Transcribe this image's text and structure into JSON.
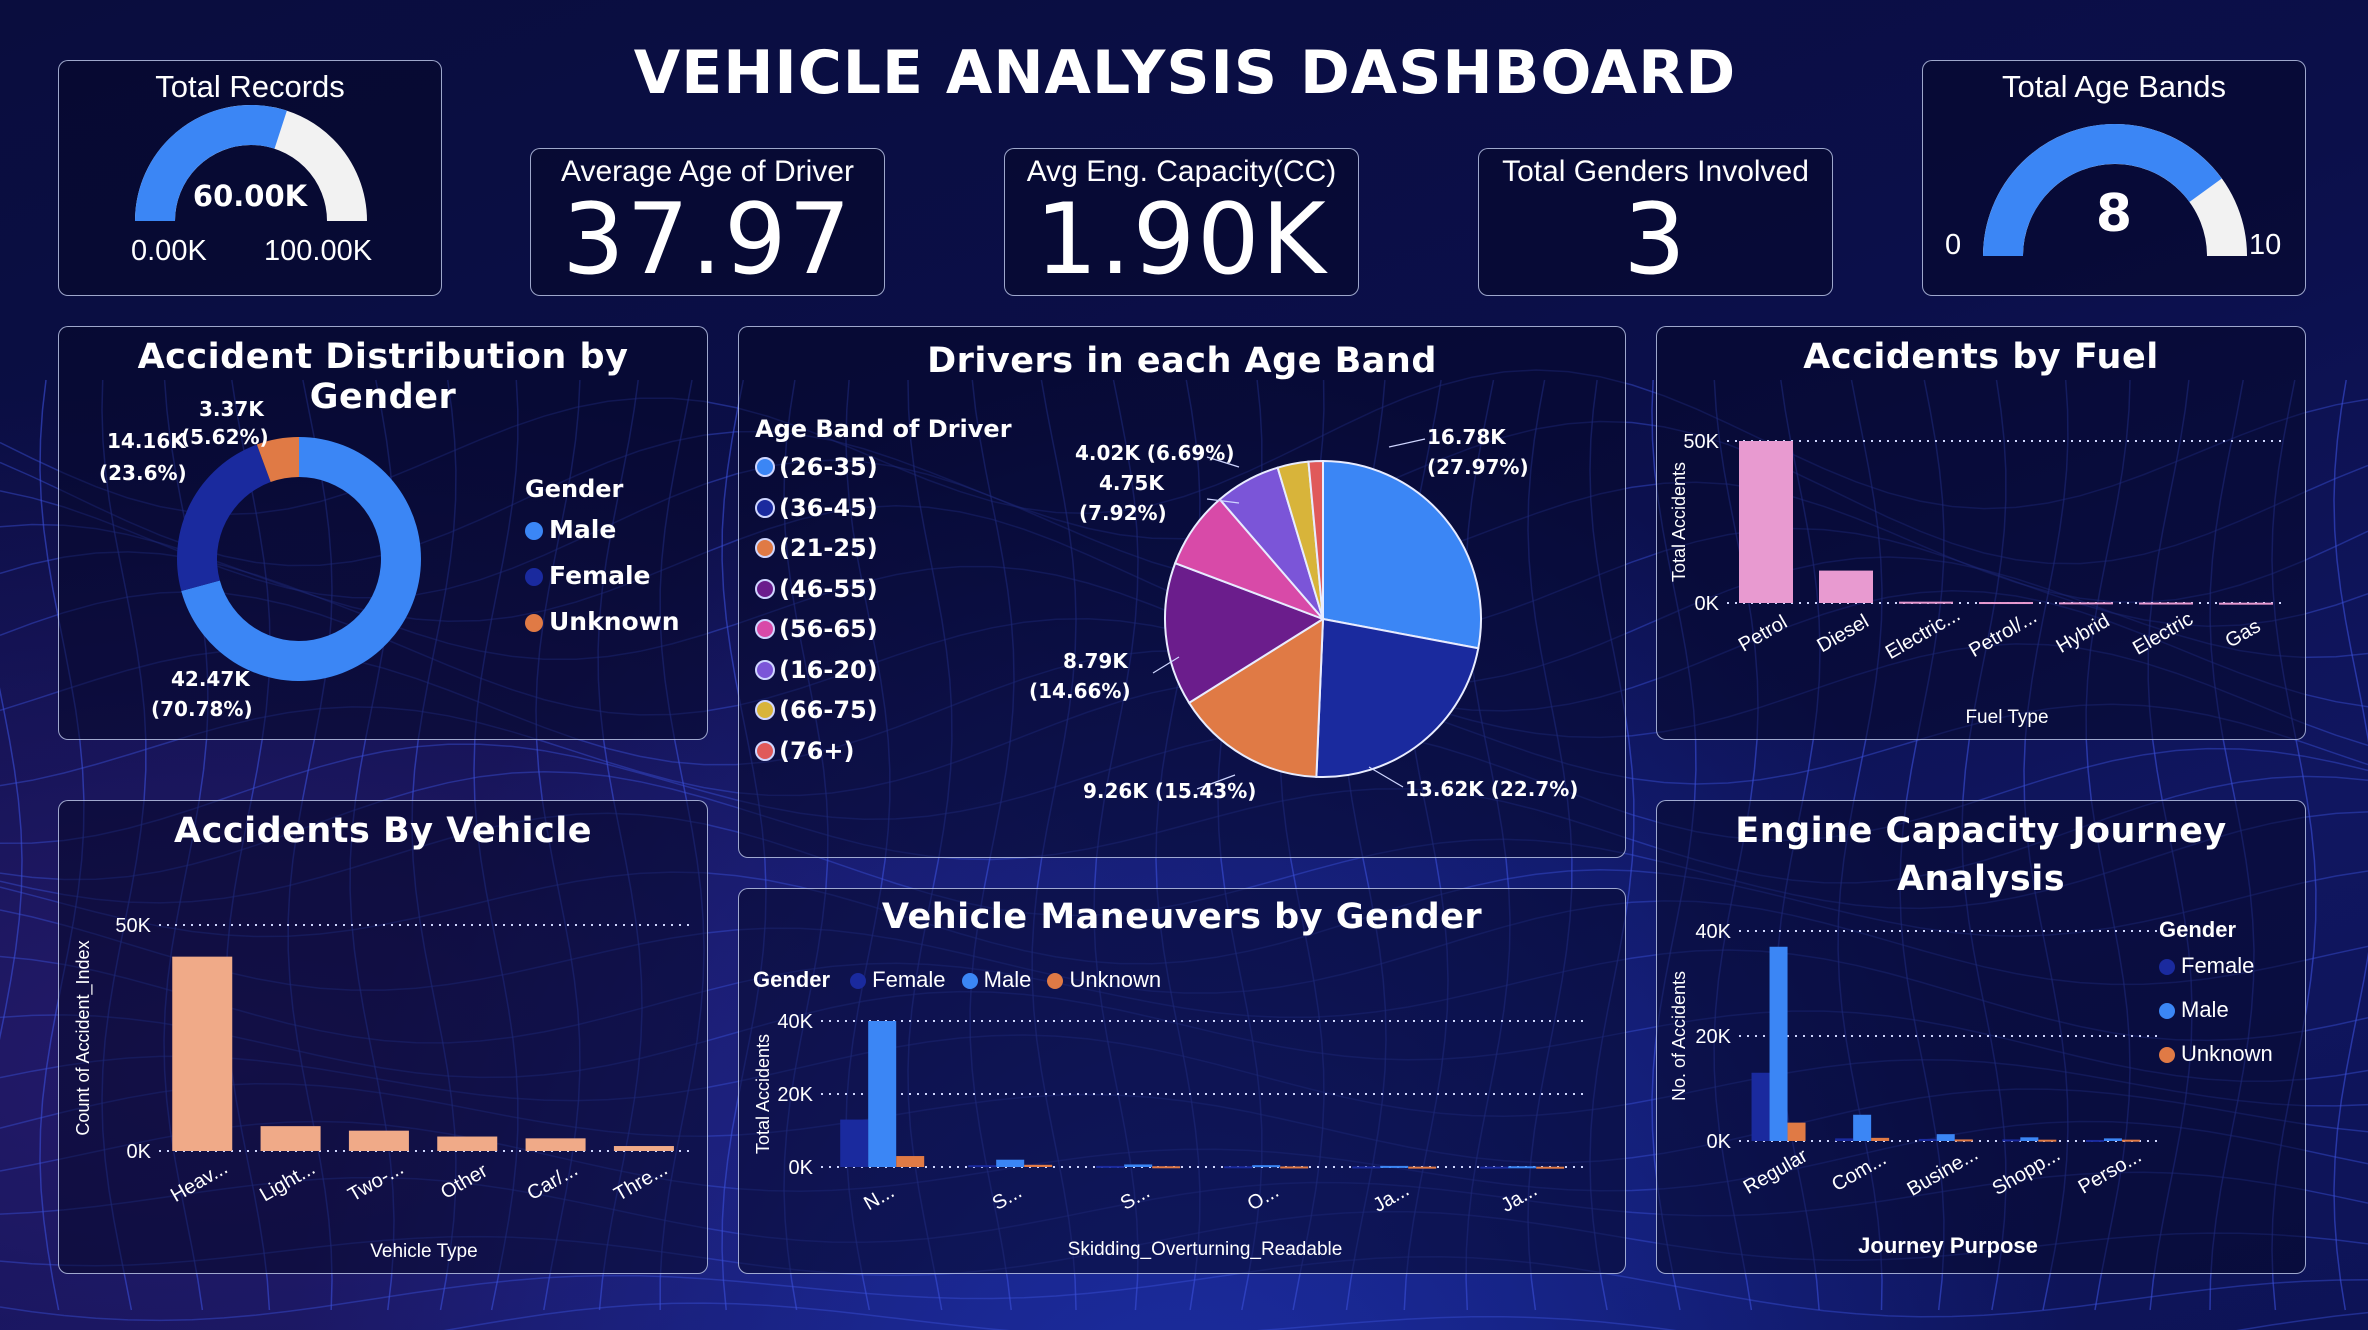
{
  "header": {
    "title": "VEHICLE ANALYSIS DASHBOARD"
  },
  "kpis": {
    "total_records": {
      "label": "Total Records",
      "value": "60.00K",
      "min": "0.00K",
      "max": "100.00K",
      "fraction": 0.6
    },
    "avg_age": {
      "label": "Average Age of Driver",
      "value": "37.97"
    },
    "avg_engine": {
      "label": "Avg Eng. Capacity(CC)",
      "value": "1.90K"
    },
    "total_genders": {
      "label": "Total Genders Involved",
      "value": "3"
    },
    "total_age_bands": {
      "label": "Total Age Bands",
      "value": "8",
      "min": "0",
      "max": "10",
      "fraction": 0.8
    }
  },
  "colors": {
    "male": "#3b86f5",
    "female": "#1a2a9e",
    "unknown": "#e07a45",
    "gauge_fill": "#3b86f5",
    "gauge_track": "#f2f2f2",
    "fuel_bar": "#e89ad0",
    "vehicle_bar": "#f0aa88"
  },
  "charts": {
    "gender_donut": {
      "title": "Accident Distribution by Gender",
      "legend_title": "Gender",
      "legend": [
        "Male",
        "Female",
        "Unknown"
      ],
      "labels": {
        "unknown_value": "3.37K",
        "unknown_pct": "(5.62%)",
        "female_value": "14.16K",
        "female_pct": "(23.6%)",
        "male_value": "42.47K",
        "male_pct": "(70.78%)"
      }
    },
    "age_band_pie": {
      "title": "Drivers in each Age Band",
      "legend_title": "Age Band of Driver",
      "legend": [
        {
          "label": "(26-35)",
          "color": "#3b86f5"
        },
        {
          "label": "(36-45)",
          "color": "#1a2a9e"
        },
        {
          "label": "(21-25)",
          "color": "#e07a45"
        },
        {
          "label": "(46-55)",
          "color": "#6b1d8c"
        },
        {
          "label": "(56-65)",
          "color": "#d84aa8"
        },
        {
          "label": "(16-20)",
          "color": "#7b55d8"
        },
        {
          "label": "(66-75)",
          "color": "#d8b43a"
        },
        {
          "label": "(76+)",
          "color": "#e05a5a"
        }
      ],
      "data_labels": {
        "a": "16.78K",
        "a_pct": "(27.97%)",
        "b": "13.62K (22.7%)",
        "c": "9.26K (15.43%)",
        "d": "8.79K",
        "d_pct": "(14.66%)",
        "e": "4.75K",
        "e_pct": "(7.92%)",
        "f": "4.02K (6.69%)"
      }
    },
    "fuel": {
      "title": "Accidents by Fuel",
      "xlabel": "Fuel Type",
      "ylabel": "Total Accidents",
      "yticks": [
        "50K",
        "0K"
      ],
      "categories": [
        "Petrol",
        "Diesel",
        "Electric...",
        "Petrol/...",
        "Hybrid",
        "Electric",
        "Gas"
      ]
    },
    "vehicle": {
      "title": "Accidents By Vehicle",
      "xlabel": "Vehicle Type",
      "ylabel": "Count of Accident_Index",
      "yticks": [
        "50K",
        "0K"
      ],
      "categories": [
        "Heav...",
        "Light...",
        "Two-...",
        "Other",
        "Car/...",
        "Thre..."
      ]
    },
    "maneuvers": {
      "title": "Vehicle Maneuvers by Gender",
      "legend_title": "Gender",
      "legend": [
        "Female",
        "Male",
        "Unknown"
      ],
      "xlabel": "Skidding_Overturning_Readable",
      "ylabel": "Total Accidents",
      "yticks": [
        "40K",
        "20K",
        "0K"
      ],
      "categories": [
        "N...",
        "S...",
        "S...",
        "O...",
        "Ja...",
        "Ja..."
      ]
    },
    "journey": {
      "title_line1": "Engine Capacity Journey",
      "title_line2": "Analysis",
      "legend_title": "Gender",
      "legend": [
        "Female",
        "Male",
        "Unknown"
      ],
      "xlabel": "Journey Purpose",
      "ylabel": "No. of Accidents",
      "yticks": [
        "40K",
        "20K",
        "0K"
      ],
      "categories": [
        "Regular",
        "Com...",
        "Busine...",
        "Shopp...",
        "Perso..."
      ]
    }
  },
  "chart_data": [
    {
      "type": "pie",
      "title": "Accident Distribution by Gender",
      "categories": [
        "Male",
        "Female",
        "Unknown"
      ],
      "values": [
        42470,
        14160,
        3370
      ]
    },
    {
      "type": "pie",
      "title": "Drivers in each Age Band",
      "categories": [
        "(26-35)",
        "(36-45)",
        "(21-25)",
        "(46-55)",
        "(56-65)",
        "(16-20)",
        "(66-75)",
        "(76+)"
      ],
      "values": [
        16780,
        13620,
        9260,
        8790,
        4750,
        4020,
        1900,
        880
      ]
    },
    {
      "type": "bar",
      "title": "Accidents by Fuel",
      "categories": [
        "Petrol",
        "Diesel",
        "Electric...",
        "Petrol/...",
        "Hybrid",
        "Electric",
        "Gas"
      ],
      "values": [
        50000,
        10000,
        400,
        300,
        200,
        150,
        100
      ],
      "xlabel": "Fuel Type",
      "ylabel": "Total Accidents",
      "ylim": [
        0,
        50000
      ]
    },
    {
      "type": "bar",
      "title": "Accidents By Vehicle",
      "categories": [
        "Heav...",
        "Light...",
        "Two-...",
        "Other",
        "Car/...",
        "Thre..."
      ],
      "values": [
        43000,
        5500,
        4500,
        3200,
        2800,
        1100
      ],
      "xlabel": "Vehicle Type",
      "ylabel": "Count of Accident_Index",
      "ylim": [
        0,
        50000
      ]
    },
    {
      "type": "bar",
      "title": "Vehicle Maneuvers by Gender",
      "categories": [
        "N...",
        "S...",
        "S...",
        "O...",
        "Ja...",
        "Ja..."
      ],
      "series": [
        {
          "name": "Female",
          "values": [
            13000,
            500,
            300,
            200,
            150,
            100
          ]
        },
        {
          "name": "Male",
          "values": [
            40000,
            2000,
            700,
            500,
            300,
            200
          ]
        },
        {
          "name": "Unknown",
          "values": [
            3000,
            600,
            200,
            150,
            100,
            80
          ]
        }
      ],
      "xlabel": "Skidding_Overturning_Readable",
      "ylabel": "Total Accidents",
      "ylim": [
        0,
        40000
      ]
    },
    {
      "type": "bar",
      "title": "Engine Capacity Journey Analysis",
      "categories": [
        "Regular",
        "Com...",
        "Busine...",
        "Shopp...",
        "Perso..."
      ],
      "series": [
        {
          "name": "Female",
          "values": [
            13000,
            500,
            400,
            300,
            200
          ]
        },
        {
          "name": "Male",
          "values": [
            37000,
            5000,
            1300,
            700,
            500
          ]
        },
        {
          "name": "Unknown",
          "values": [
            3500,
            600,
            300,
            250,
            250
          ]
        }
      ],
      "xlabel": "Journey Purpose",
      "ylabel": "No. of Accidents",
      "ylim": [
        0,
        40000
      ]
    }
  ]
}
